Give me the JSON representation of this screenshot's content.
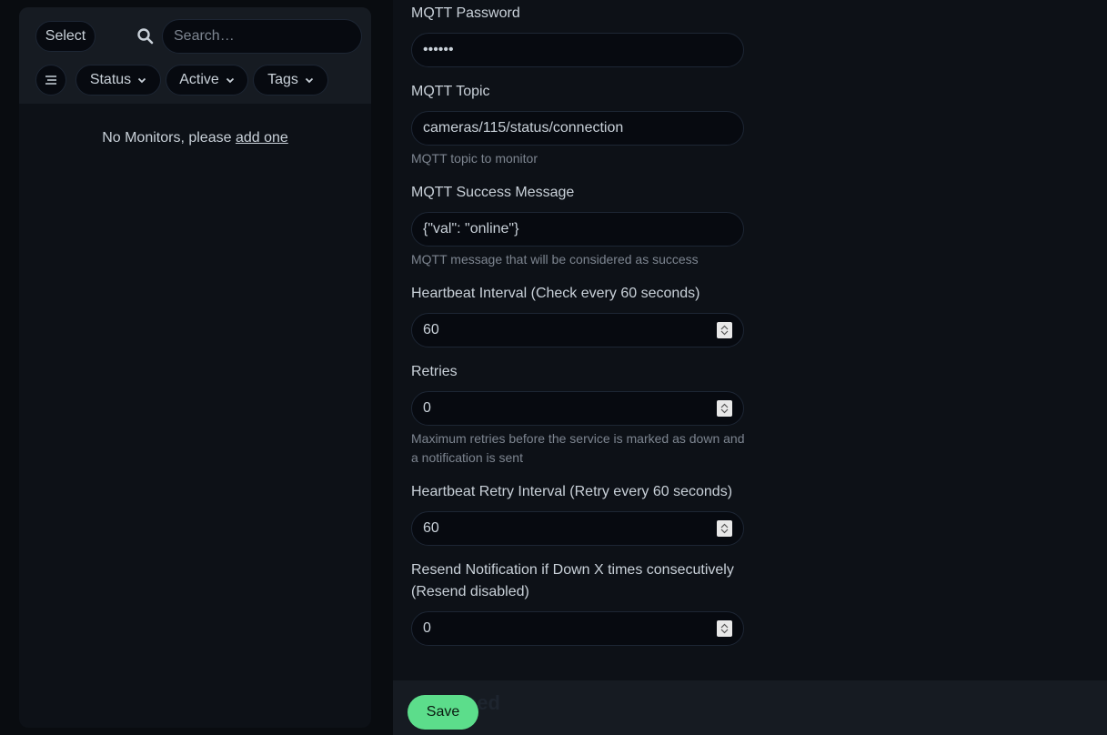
{
  "sidebar": {
    "select_label": "Select",
    "search_placeholder": "Search…",
    "filters": {
      "status_label": "Status",
      "active_label": "Active",
      "tags_label": "Tags"
    },
    "empty_text": "No Monitors, please",
    "empty_link": "add one"
  },
  "form": {
    "mqtt_password": {
      "label": "MQTT Password",
      "value": "••••••"
    },
    "mqtt_topic": {
      "label": "MQTT Topic",
      "value": "cameras/115/status/connection",
      "help": "MQTT topic to monitor"
    },
    "mqtt_success": {
      "label": "MQTT Success Message",
      "value": "{\"val\": \"online\"}",
      "help": "MQTT message that will be considered as success"
    },
    "heartbeat_interval": {
      "label": "Heartbeat Interval (Check every 60 seconds)",
      "value": "60"
    },
    "retries": {
      "label": "Retries",
      "value": "0",
      "help": "Maximum retries before the service is marked as down and a notification is sent"
    },
    "retry_interval": {
      "label": "Heartbeat Retry Interval (Retry every 60 seconds)",
      "value": "60"
    },
    "resend": {
      "label_line1": "Resend Notification if Down X times consecutively",
      "label_line2": "(Resend disabled)",
      "value": "0"
    }
  },
  "footer": {
    "save_label": "Save",
    "hidden_heading": "ced"
  },
  "colors": {
    "accent_green": "#5cdd8b",
    "background": "#0d1117",
    "panel": "#161b22"
  }
}
